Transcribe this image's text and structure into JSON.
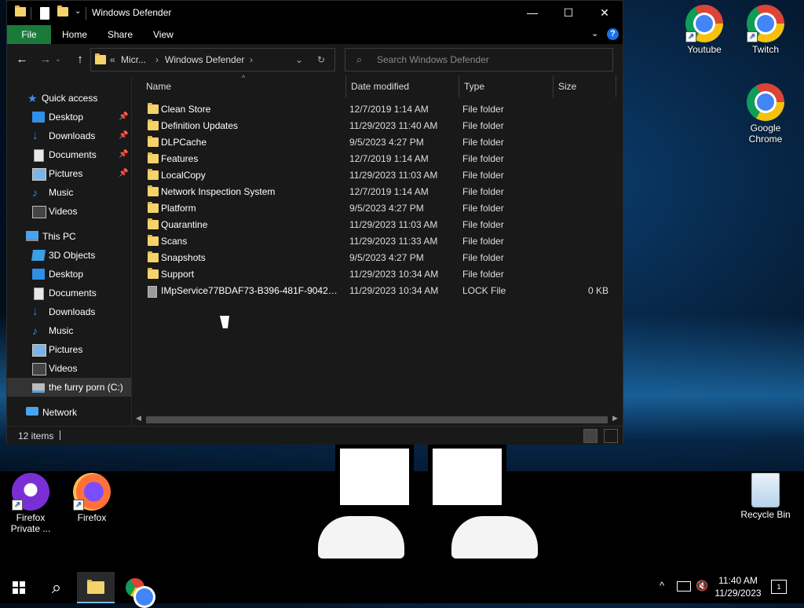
{
  "window": {
    "title": "Windows Defender",
    "controls": {
      "minimize": "—",
      "maximize": "☐",
      "close": "✕"
    }
  },
  "ribbon": {
    "tabs": [
      "File",
      "Home",
      "Share",
      "View"
    ],
    "expand": "⌄",
    "help": "?"
  },
  "nav": {
    "back": "←",
    "forward": "→",
    "up": "↑",
    "path_overflow": "«",
    "path": [
      "Micr...",
      "Windows Defender"
    ],
    "sep": "›",
    "dropdown": "⌄",
    "refresh": "↻"
  },
  "search": {
    "placeholder": "Search Windows Defender",
    "icon": "⌕"
  },
  "sidebar": {
    "quick_access": "Quick access",
    "quick_items": [
      {
        "label": "Desktop"
      },
      {
        "label": "Downloads"
      },
      {
        "label": "Documents"
      },
      {
        "label": "Pictures"
      },
      {
        "label": "Music"
      },
      {
        "label": "Videos"
      }
    ],
    "pin": "📌",
    "this_pc": "This PC",
    "pc_items": [
      {
        "label": "3D Objects"
      },
      {
        "label": "Desktop"
      },
      {
        "label": "Documents"
      },
      {
        "label": "Downloads"
      },
      {
        "label": "Music"
      },
      {
        "label": "Pictures"
      },
      {
        "label": "Videos"
      },
      {
        "label": "the furry porn (C:)"
      }
    ],
    "network": "Network"
  },
  "columns": {
    "name": "Name",
    "date": "Date modified",
    "type": "Type",
    "size": "Size",
    "sort": "^"
  },
  "files": [
    {
      "name": "Clean Store",
      "date": "12/7/2019 1:14 AM",
      "type": "File folder",
      "size": ""
    },
    {
      "name": "Definition Updates",
      "date": "11/29/2023 11:40 AM",
      "type": "File folder",
      "size": ""
    },
    {
      "name": "DLPCache",
      "date": "9/5/2023 4:27 PM",
      "type": "File folder",
      "size": ""
    },
    {
      "name": "Features",
      "date": "12/7/2019 1:14 AM",
      "type": "File folder",
      "size": ""
    },
    {
      "name": "LocalCopy",
      "date": "11/29/2023 11:03 AM",
      "type": "File folder",
      "size": ""
    },
    {
      "name": "Network Inspection System",
      "date": "12/7/2019 1:14 AM",
      "type": "File folder",
      "size": ""
    },
    {
      "name": "Platform",
      "date": "9/5/2023 4:27 PM",
      "type": "File folder",
      "size": ""
    },
    {
      "name": "Quarantine",
      "date": "11/29/2023 11:03 AM",
      "type": "File folder",
      "size": ""
    },
    {
      "name": "Scans",
      "date": "11/29/2023 11:33 AM",
      "type": "File folder",
      "size": ""
    },
    {
      "name": "Snapshots",
      "date": "9/5/2023 4:27 PM",
      "type": "File folder",
      "size": ""
    },
    {
      "name": "Support",
      "date": "11/29/2023 10:34 AM",
      "type": "File folder",
      "size": ""
    },
    {
      "name": "IMpService77BDAF73-B396-481F-9042-A...",
      "date": "11/29/2023 10:34 AM",
      "type": "LOCK File",
      "size": "0 KB"
    }
  ],
  "status": {
    "count": "12 items"
  },
  "desktop": {
    "icons": [
      {
        "label": "Youtube"
      },
      {
        "label": "Twitch"
      },
      {
        "label": "Google Chrome"
      },
      {
        "label": "Firefox Private ..."
      },
      {
        "label": "Firefox"
      },
      {
        "label": "Recycle Bin"
      }
    ]
  },
  "taskbar": {
    "search": "⌕",
    "tray_chevron": "^",
    "clock_time": "11:40 AM",
    "clock_date": "11/29/2023",
    "notification_count": "1"
  },
  "colors": {
    "file_tab": "#1a7a3a",
    "accent": "#76b9ed",
    "folder": "#f5d36b"
  }
}
